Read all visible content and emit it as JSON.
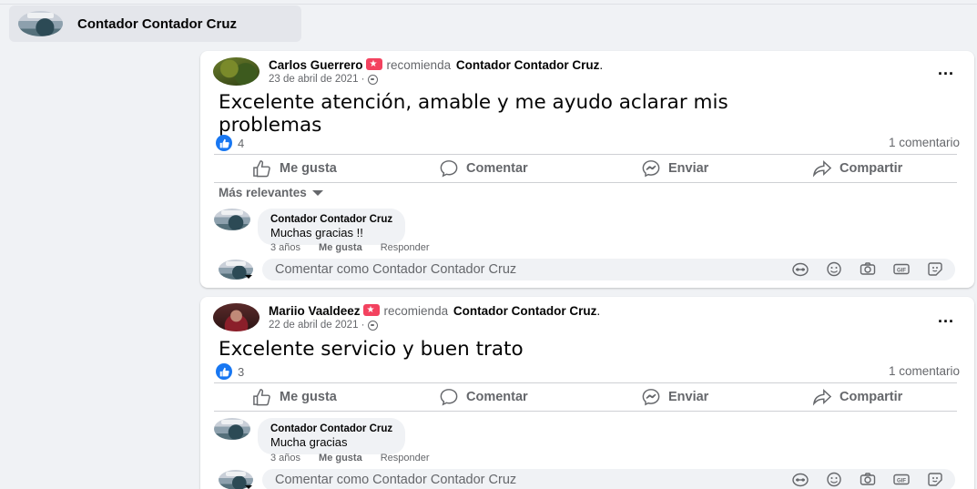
{
  "page_chip": {
    "name": "Contador Contador Cruz"
  },
  "posts": [
    {
      "author": "Carlos Guerrero",
      "verb": "recomienda",
      "page": "Contador Contador Cruz",
      "punct": ".",
      "date": "23 de abril de 2021 ·",
      "text_line1": "Excelente atención, amable y me ayudo aclarar mis",
      "text_line2": "problemas",
      "likes": "4",
      "comments_label": "1 comentario",
      "actions": {
        "like": "Me gusta",
        "comment": "Comentar",
        "send": "Enviar",
        "share": "Compartir"
      },
      "sort_label": "Más relevantes",
      "comment": {
        "author": "Contador Contador Cruz",
        "text": "Muchas gracias !!",
        "age": "3 años",
        "like": "Me gusta",
        "reply": "Responder"
      },
      "compose_placeholder": "Comentar como Contador Contador Cruz"
    },
    {
      "author": "Mariio Vaaldeez",
      "verb": "recomienda",
      "page": "Contador Contador Cruz",
      "punct": ".",
      "date": "22 de abril de 2021 ·",
      "text_line1": "Excelente servicio y buen trato",
      "likes": "3",
      "comments_label": "1 comentario",
      "actions": {
        "like": "Me gusta",
        "comment": "Comentar",
        "send": "Enviar",
        "share": "Compartir"
      },
      "comment": {
        "author": "Contador Contador Cruz",
        "text": "Mucha gracias",
        "age": "3 años",
        "like": "Me gusta",
        "reply": "Responder"
      },
      "compose_placeholder": "Comentar como Contador Contador Cruz"
    }
  ],
  "more_label": "...",
  "colors": {
    "accent": "#1877f2",
    "recommend_badge": "#f3425f",
    "background": "#f0f2f5"
  },
  "icons": [
    "like-icon",
    "comment-icon",
    "messenger-icon",
    "share-icon",
    "globe-icon",
    "avatar-sticker-icon",
    "emoji-icon",
    "camera-icon",
    "gif-icon",
    "sticker-icon"
  ]
}
